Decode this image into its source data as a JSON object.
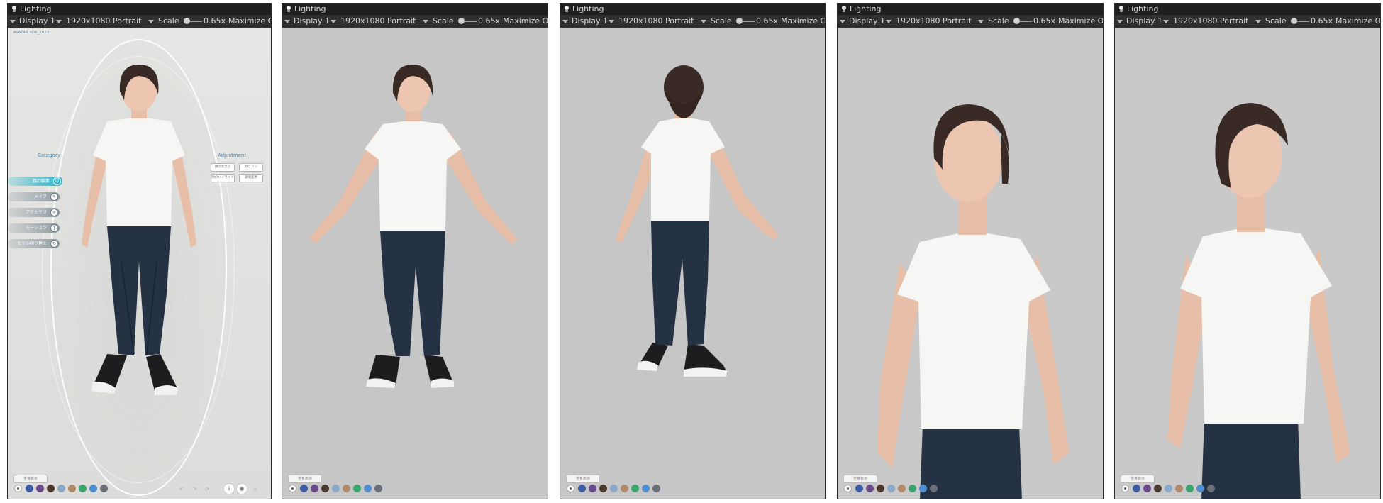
{
  "window_title": "Lighting",
  "toolbar": {
    "display": "Display 1",
    "resolution": "1920x1080 Portrait",
    "scale_label": "Scale",
    "scale_value": "0.65x",
    "maximize": "Maximize On P"
  },
  "app": {
    "brand": "AVATAR SDK_2023",
    "category_title": "Category",
    "adjustment_title": "Adjustment",
    "menu": [
      {
        "label": "顔の編集",
        "icon": "face-icon"
      },
      {
        "label": "メイク",
        "icon": "makeup-icon"
      },
      {
        "label": "アクセサリ",
        "icon": "accessory-icon"
      },
      {
        "label": "モーション",
        "icon": "motion-icon"
      },
      {
        "label": "モデル切り替え",
        "icon": "switch-model-icon"
      }
    ],
    "adjustments": [
      "顔の大きさ",
      "カラコン",
      "顔のハイライト",
      "表情変更"
    ],
    "bottom_button": "全身表示"
  },
  "swatch_colors": [
    "#3e5fa8",
    "#6b4a8c",
    "#4d3b30",
    "#8aa8c8",
    "#b08a6a",
    "#3aa56d",
    "#4f8ed0",
    "#6a6f7a"
  ],
  "colors": {
    "title_bar": "#1f1f1f",
    "toolbar": "#303030",
    "accent": "#27b7cc",
    "shirt": "#f4f4f2",
    "jeans": "#243244",
    "hair": "#3a2a26",
    "skin": "#e8bfa8"
  }
}
